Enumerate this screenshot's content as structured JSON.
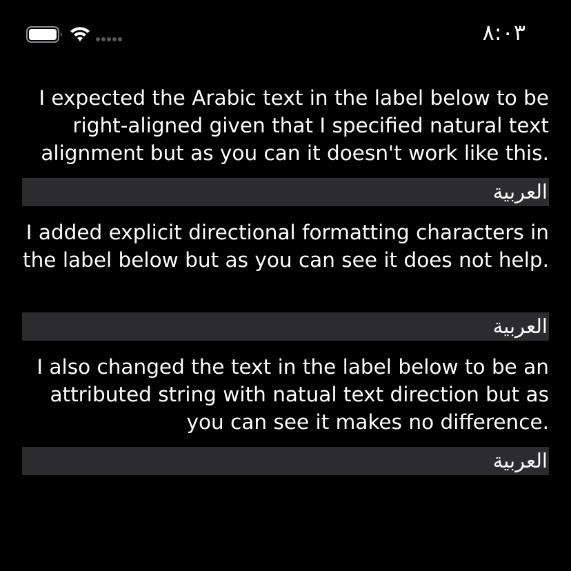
{
  "status_bar": {
    "time": "٨:٠٣",
    "battery_icon": "battery-full-icon",
    "wifi_icon": "wifi-icon",
    "signal_icon": "cellular-signal-icon"
  },
  "blocks": [
    {
      "description": "I expected the Arabic text in the label below to be right-aligned given that I specified natural text alignment but as you can it doesn't work like this.",
      "label": "العربية"
    },
    {
      "description": "I added explicit directional formatting characters in the label below but as you can see it does not help.",
      "label": "العربية"
    },
    {
      "description": "I also changed the text in the label below to be an attributed string with natual text direction but as you can see it makes no difference.",
      "label": "العربية"
    }
  ],
  "colors": {
    "background": "#000000",
    "text": "#ffffff",
    "label_background": "#2c2c2e"
  }
}
